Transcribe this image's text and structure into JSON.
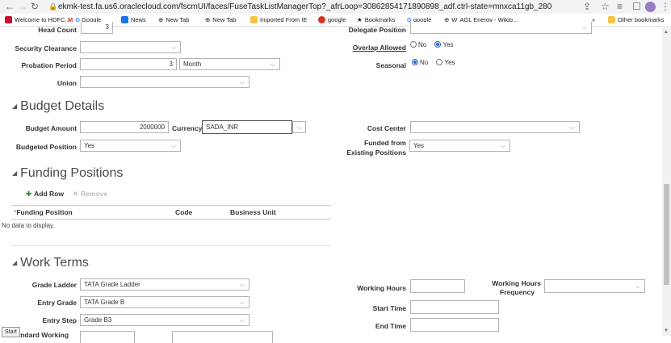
{
  "browser": {
    "url": "ekmk-test.fa.us6.oraclecloud.com/fscmUI/faces/FuseTaskListManagerTop?_afrLoop=30862854171890898_adf.ctrl-state=mnxca11gb_280",
    "bookmarks": [
      "Welcome to HDFC...",
      "Google",
      "News",
      "New Tab",
      "New Tab",
      "Imported From IE",
      "google",
      "Bookmarks",
      "google",
      "AGL Energy - Wikip..."
    ],
    "other_bookmarks": "Other bookmarks",
    "more": "»"
  },
  "top": {
    "head_count_label": "Head Count",
    "head_count_value": "3",
    "security_label": "Security Clearance",
    "probation_label": "Probation Period",
    "probation_value": "3",
    "probation_unit": "Month",
    "union_label": "Union",
    "delegate_label": "Delegate Position",
    "overlap_label": "Overlap Allowed",
    "no": "No",
    "yes": "Yes",
    "seasonal_label": "Seasonal"
  },
  "budget": {
    "title": "Budget Details",
    "amount_label": "Budget Amount",
    "amount_value": "2000000",
    "currency_label": "Currency",
    "currency_value": "SADA_INR",
    "budgeted_label": "Budgeted Position",
    "budgeted_value": "Yes",
    "cost_center_label": "Cost Center",
    "funded_label_1": "Funded from",
    "funded_label_2": "Existing Positions",
    "funded_value": "Yes"
  },
  "funding": {
    "title": "Funding Positions",
    "add_row": "Add Row",
    "remove": "Remove",
    "columns": [
      "Funding Position",
      "Code",
      "Business Unit"
    ],
    "required_mark": "*",
    "empty": "No data to display."
  },
  "work": {
    "title": "Work Terms",
    "grade_ladder_label": "Grade Ladder",
    "grade_ladder_value": "TATA Grade Ladder",
    "entry_grade_label": "Entry Grade",
    "entry_grade_value": "TATA Grade B",
    "entry_step_label": "Entry Step",
    "entry_step_value": "Grade B3",
    "standard_label": "Standard Working",
    "working_hours_label": "Working Hours",
    "frequency_label_1": "Working Hours",
    "frequency_label_2": "Frequency",
    "start_time_label": "Start Time",
    "end_time_label": "End Time"
  },
  "status": "Start"
}
